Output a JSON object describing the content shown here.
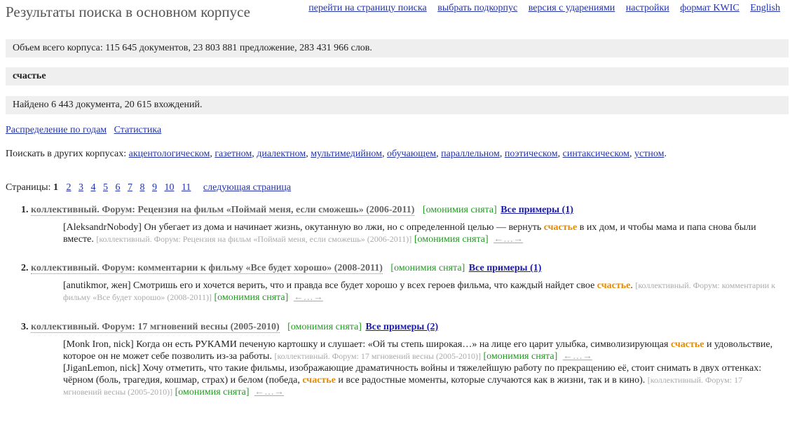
{
  "header": {
    "title": "Результаты поиска в основном корпусе",
    "nav": [
      "перейти на страницу поиска",
      "выбрать подкорпус",
      "версия с ударениями",
      "настройки",
      "формат KWIC",
      "English"
    ]
  },
  "corpus_info": "Объем всего корпуса: 115 645 документов, 23 803 881 предложение, 283 431 966 слов.",
  "query": "счастье",
  "found": "Найдено 6 443 документа, 20 615 вхождений.",
  "links": [
    "Распределение по годам",
    "Статистика"
  ],
  "other_corpora": {
    "label": "Поискать в других корпусах:",
    "items": [
      "акцентологическом",
      "газетном",
      "диалектном",
      "мультимедийном",
      "обучающем",
      "параллельном",
      "поэтическом",
      "синтаксическом",
      "устном"
    ]
  },
  "pages": {
    "label": "Страницы:",
    "current": "1",
    "items": [
      "2",
      "3",
      "4",
      "5",
      "6",
      "7",
      "8",
      "9",
      "10",
      "11"
    ],
    "next": "следующая страница"
  },
  "results": [
    {
      "num": "1.",
      "title": "коллективный. Форум: Рецензия на фильм «Поймай меня, если сможешь» (2006-2011)",
      "homonymy": "[омонимия снята]",
      "all": "Все примеры (1)",
      "snippets": [
        {
          "author": "[AleksandrNobody]",
          "before": "Он убегает из дома и начинает жизнь, окутанную во лжи, но с определенной целью — вернуть",
          "hit": "счастье",
          "after": "в их дом, и чтобы мама и папа снова были вместе.",
          "src": "[коллективный. Форум: Рецензия на фильм «Поймай меня, если сможешь» (2006-2011)]",
          "hom": "[омонимия снята]",
          "ctx": "←…→"
        }
      ]
    },
    {
      "num": "2.",
      "title": "коллективный. Форум: комментарии к фильму «Все будет хорошо» (2008-2011)",
      "homonymy": "[омонимия снята]",
      "all": "Все примеры (1)",
      "snippets": [
        {
          "author": "[anutikmor, жен]",
          "before": "Смотришь его и хочется верить, что и правда все будет хорошо у всех героев фильма, что каждый найдет свое",
          "hit": "счастье",
          "after": ".",
          "src": "[коллективный. Форум: комментарии к фильму «Все будет хорошо» (2008-2011)]",
          "hom": "[омонимия снята]",
          "ctx": "←…→"
        }
      ]
    },
    {
      "num": "3.",
      "title": "коллективный. Форум: 17 мгновений весны (2005-2010)",
      "homonymy": "[омонимия снята]",
      "all": "Все примеры (2)",
      "snippets": [
        {
          "author": "[Monk Iron, nick]",
          "before": "Когда он есть РУКАМИ печеную картошку и слушает: «Ой ты степь широкая…» на лице его царит улыбка, символизирующая",
          "hit": "счастье",
          "after": "и удовольствие, которое он не может себе позволить из-за работы.",
          "src": "[коллективный. Форум: 17 мгновений весны (2005-2010)]",
          "hom": "[омонимия снята]",
          "ctx": "←…→"
        },
        {
          "author": "[JiganLemon, nick]",
          "before": "Хочу отметить, что такие фильмы, изображающие драматичность войны и тяжелейшую работу по прекращению её, стоит снимать в двух оттенках: чёрном (боль, трагедия, кошмар, страх) и белом (победа,",
          "hit": "счастье",
          "after": "и все радостные моменты, которые случаются как в жизни, так и в кино).",
          "src": "[коллективный. Форум: 17 мгновений весны (2005-2010)]",
          "hom": "[омонимия снята]",
          "ctx": "←…→"
        }
      ]
    }
  ]
}
